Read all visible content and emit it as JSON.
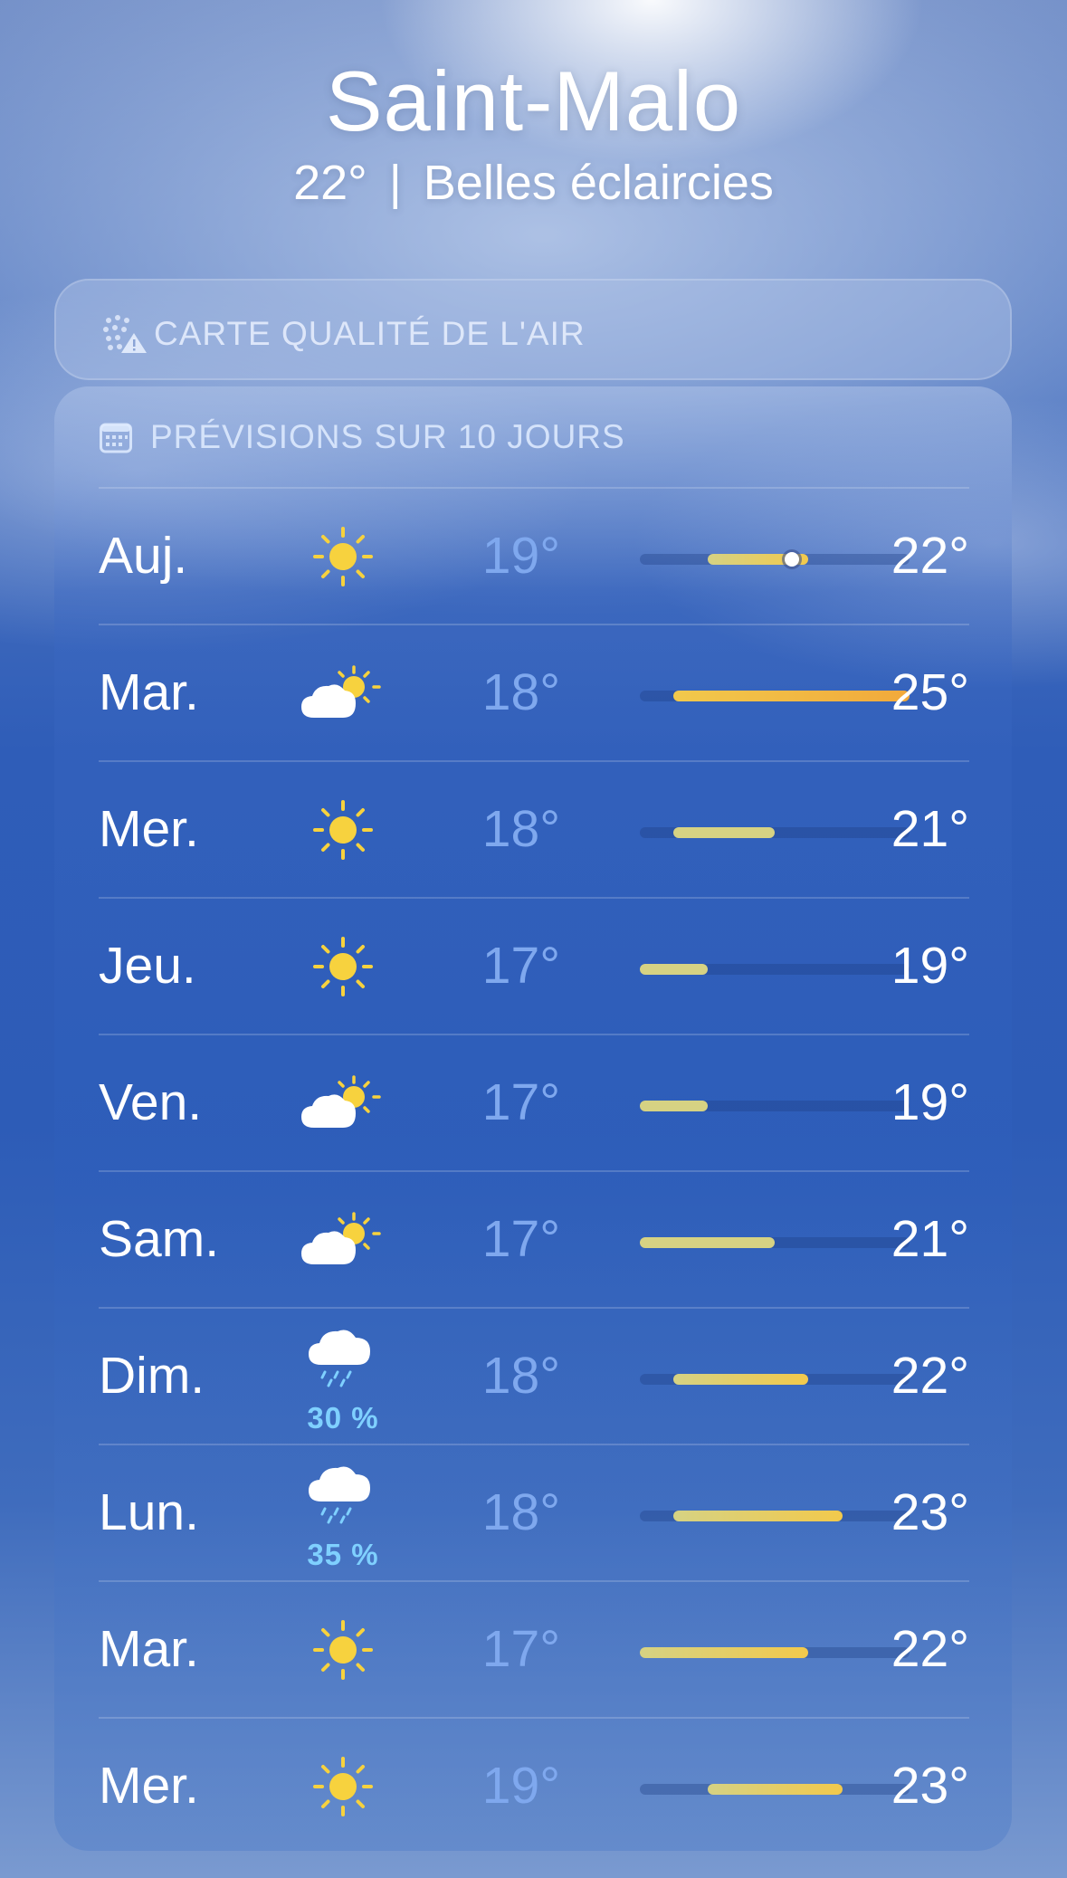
{
  "header": {
    "city": "Saint-Malo",
    "current_temp": "22°",
    "separator": "|",
    "condition": "Belles éclaircies"
  },
  "air_quality_card": {
    "title": "CARTE QUALITÉ DE L'AIR",
    "icon": "air-quality-map-icon"
  },
  "forecast": {
    "title": "PRÉVISIONS SUR 10 JOURS",
    "icon": "calendar-icon",
    "range_min": 17,
    "range_max": 25,
    "current_temp_value": 22,
    "colors": {
      "low_text": "#7fa8ee",
      "precip_text": "#7fd0ff",
      "bar_cool": "#d6d283",
      "bar_warm": "#f2c94c",
      "bar_hot": "#f2a93b"
    },
    "days": [
      {
        "day": "Auj.",
        "icon": "sun-icon",
        "precip": "",
        "low": "19°",
        "high": "22°",
        "low_value": 19,
        "high_value": 22,
        "is_today": true
      },
      {
        "day": "Mar.",
        "icon": "partly-cloudy-icon",
        "precip": "",
        "low": "18°",
        "high": "25°",
        "low_value": 18,
        "high_value": 25,
        "is_today": false
      },
      {
        "day": "Mer.",
        "icon": "sun-icon",
        "precip": "",
        "low": "18°",
        "high": "21°",
        "low_value": 18,
        "high_value": 21,
        "is_today": false
      },
      {
        "day": "Jeu.",
        "icon": "sun-icon",
        "precip": "",
        "low": "17°",
        "high": "19°",
        "low_value": 17,
        "high_value": 19,
        "is_today": false
      },
      {
        "day": "Ven.",
        "icon": "partly-cloudy-icon",
        "precip": "",
        "low": "17°",
        "high": "19°",
        "low_value": 17,
        "high_value": 19,
        "is_today": false
      },
      {
        "day": "Sam.",
        "icon": "partly-cloudy-icon",
        "precip": "",
        "low": "17°",
        "high": "21°",
        "low_value": 17,
        "high_value": 21,
        "is_today": false
      },
      {
        "day": "Dim.",
        "icon": "rain-cloud-icon",
        "precip": "30 %",
        "low": "18°",
        "high": "22°",
        "low_value": 18,
        "high_value": 22,
        "is_today": false
      },
      {
        "day": "Lun.",
        "icon": "rain-cloud-icon",
        "precip": "35 %",
        "low": "18°",
        "high": "23°",
        "low_value": 18,
        "high_value": 23,
        "is_today": false
      },
      {
        "day": "Mar.",
        "icon": "sun-icon",
        "precip": "",
        "low": "17°",
        "high": "22°",
        "low_value": 17,
        "high_value": 22,
        "is_today": false
      },
      {
        "day": "Mer.",
        "icon": "sun-icon",
        "precip": "",
        "low": "19°",
        "high": "23°",
        "low_value": 19,
        "high_value": 23,
        "is_today": false
      }
    ]
  }
}
